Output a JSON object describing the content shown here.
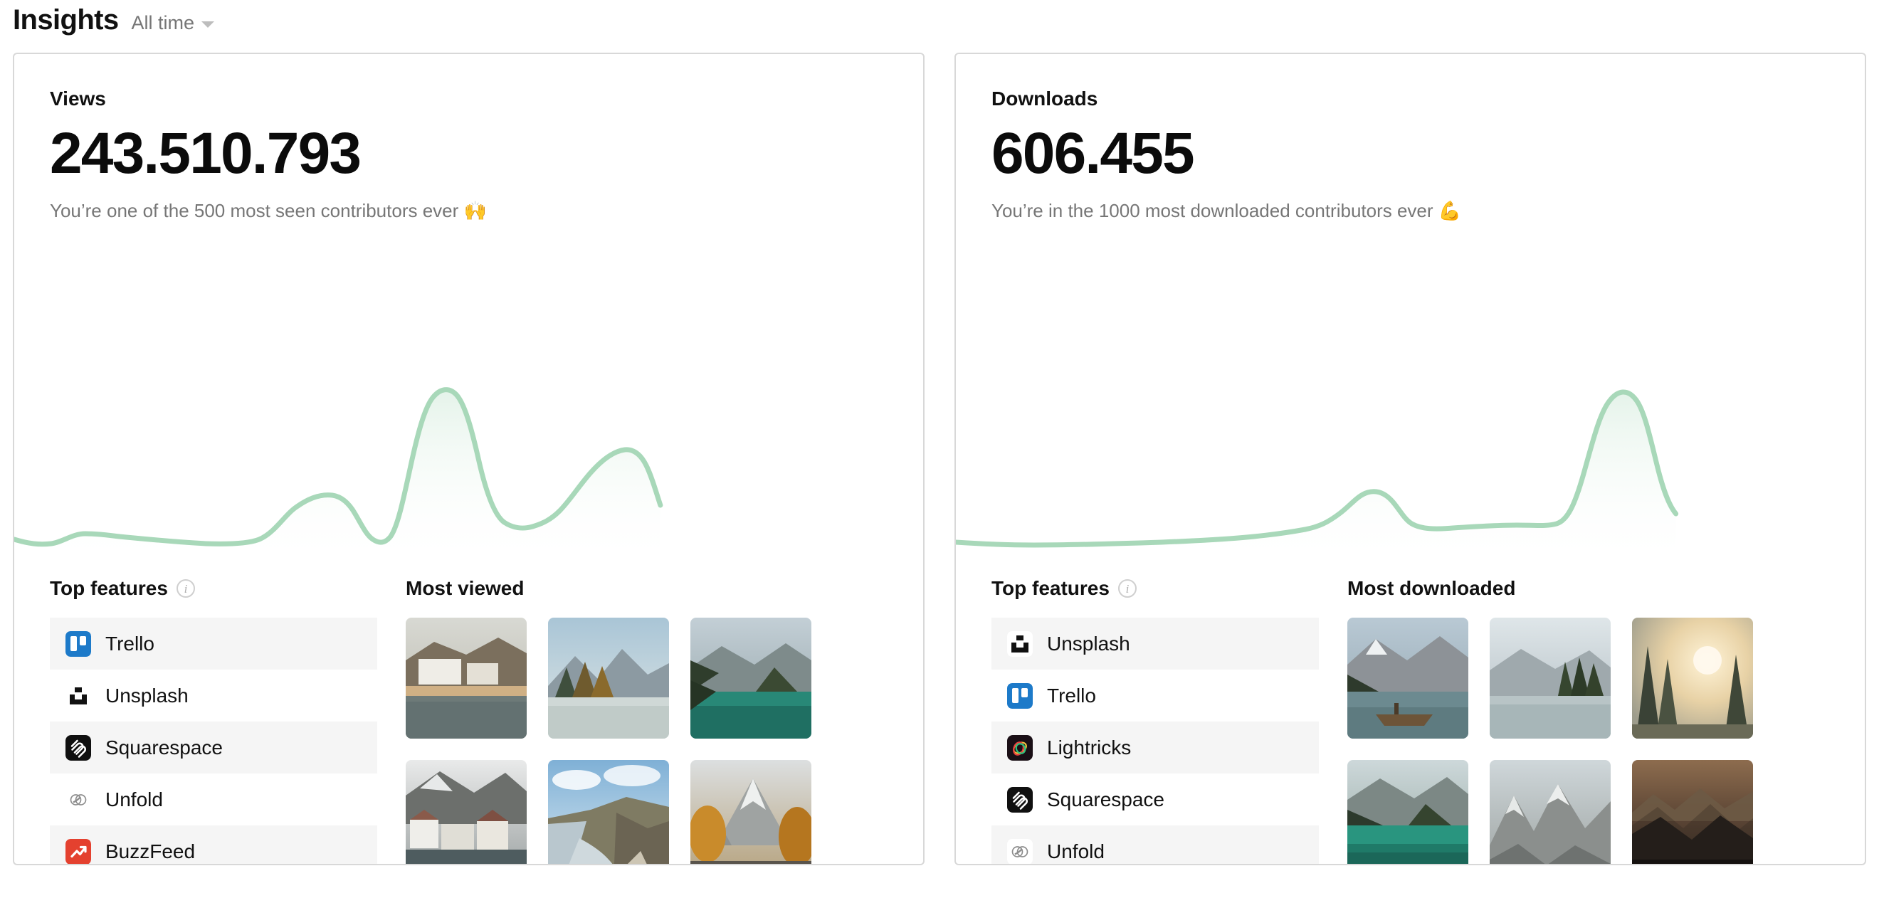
{
  "header": {
    "title": "Insights",
    "range_label": "All time",
    "caret_icon": "chevron-down-icon"
  },
  "colors": {
    "spark_stroke": "#a8d8b9",
    "spark_fill_top": "#dff0e6",
    "row_alt_bg": "#f5f5f5",
    "card_border": "#d8d8d8",
    "text_primary": "#111111",
    "text_muted": "#767676"
  },
  "cards": [
    {
      "metric_label": "Views",
      "metric_value": "243.510.793",
      "metric_sub": "You’re one of the 500 most seen contributors ever 🙌",
      "features_title": "Top features",
      "features_info_icon": "info-icon",
      "features": [
        {
          "name": "Trello",
          "icon": "trello-icon"
        },
        {
          "name": "Unsplash",
          "icon": "unsplash-icon"
        },
        {
          "name": "Squarespace",
          "icon": "squarespace-icon"
        },
        {
          "name": "Unfold",
          "icon": "unfold-icon"
        },
        {
          "name": "BuzzFeed",
          "icon": "buzzfeed-icon"
        }
      ],
      "media_title": "Most viewed",
      "media": [
        {
          "name": "lakeside-village-autumn-thumbnail"
        },
        {
          "name": "mountain-lake-pines-thumbnail"
        },
        {
          "name": "turquoise-alpine-lake-thumbnail"
        },
        {
          "name": "hallstatt-snow-village-thumbnail"
        },
        {
          "name": "rocky-coastline-waves-thumbnail"
        },
        {
          "name": "autumn-road-mountains-thumbnail"
        }
      ],
      "chart_data": {
        "type": "area",
        "title": "Views over time",
        "xlabel": "",
        "ylabel": "Views",
        "grid": false,
        "legend": "none",
        "x": [
          0,
          1,
          2,
          3,
          4,
          5,
          6,
          7,
          8,
          9,
          10,
          11,
          12,
          13,
          14,
          15,
          16,
          17,
          18,
          19,
          20,
          21,
          22,
          23
        ],
        "values": [
          8,
          6,
          11,
          11,
          10,
          9,
          8,
          8,
          9,
          24,
          32,
          30,
          16,
          12,
          14,
          92,
          90,
          60,
          30,
          18,
          17,
          22,
          55,
          66,
          52
        ]
      }
    },
    {
      "metric_label": "Downloads",
      "metric_value": "606.455",
      "metric_sub": "You’re in the 1000 most downloaded contributors ever 💪",
      "features_title": "Top features",
      "features_info_icon": "info-icon",
      "features": [
        {
          "name": "Unsplash",
          "icon": "unsplash-icon"
        },
        {
          "name": "Trello",
          "icon": "trello-icon"
        },
        {
          "name": "Lightricks",
          "icon": "lightricks-icon"
        },
        {
          "name": "Squarespace",
          "icon": "squarespace-icon"
        },
        {
          "name": "Unfold",
          "icon": "unfold-icon"
        }
      ],
      "media_title": "Most downloaded",
      "media": [
        {
          "name": "boat-on-mountain-lake-thumbnail"
        },
        {
          "name": "misty-forest-lake-thumbnail"
        },
        {
          "name": "sunrise-through-pines-thumbnail"
        },
        {
          "name": "emerald-lake-forest-thumbnail"
        },
        {
          "name": "rocky-peak-ridge-thumbnail"
        },
        {
          "name": "dark-mountain-range-thumbnail"
        }
      ],
      "chart_data": {
        "type": "area",
        "title": "Downloads over time",
        "xlabel": "",
        "ylabel": "Downloads",
        "grid": false,
        "legend": "none",
        "x": [
          0,
          1,
          2,
          3,
          4,
          5,
          6,
          7,
          8,
          9,
          10,
          11,
          12,
          13,
          14,
          15,
          16,
          17,
          18,
          19,
          20,
          21,
          22,
          23
        ],
        "values": [
          6,
          6,
          7,
          7,
          8,
          8,
          9,
          12,
          14,
          13,
          12,
          28,
          30,
          25,
          24,
          26,
          26,
          22,
          20,
          34,
          88,
          92,
          70,
          62,
          50
        ]
      }
    }
  ]
}
